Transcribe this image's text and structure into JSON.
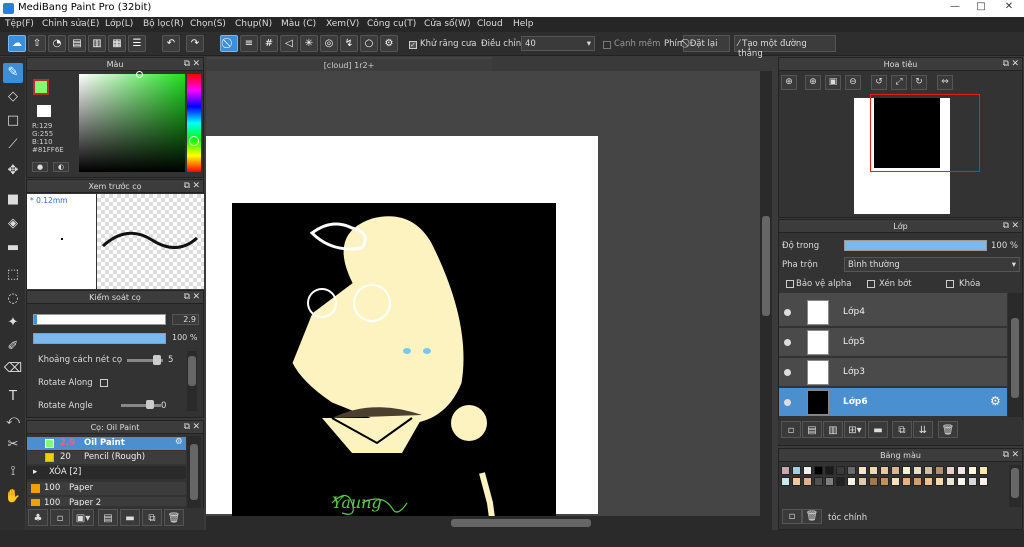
{
  "window": {
    "title": "MediBang Paint Pro (32bit)",
    "buttons": [
      "—",
      "□",
      "✕"
    ]
  },
  "menu": [
    "Tệp(F)",
    "Chỉnh sửa(E)",
    "Lớp(L)",
    "Bộ lọc(R)",
    "Chọn(S)",
    "Chụp(N)",
    "Màu (C)",
    "Xem(V)",
    "Công cụ(T)",
    "Cửa số(W)",
    "Cloud",
    "Help"
  ],
  "toolbar": {
    "antialias_label": "Khử răng cưa",
    "adjust_label": "Điều chỉnh",
    "adjust_value": "40",
    "edge_label": "Cạnh mềm",
    "shortcut_label": "Phím",
    "reset_label": "Đặt lại",
    "straight_label": "Tạo một đường thẳng"
  },
  "color_panel": {
    "title": "Màu",
    "r": "R:129",
    "g": "G:255",
    "b": "B:110",
    "hex": "#81FF6E",
    "accent": "#81FF6E"
  },
  "brush_preview": {
    "title": "Xem trước cọ",
    "size": "* 0.12mm"
  },
  "brush_control": {
    "title": "Kiểm soát cọ",
    "size": "2.9",
    "opacity": "100 %",
    "opacity_fraction": 1,
    "spacing_label": "Khoảng cách nét cọ",
    "spacing_value": "5",
    "rotate_along": "Rotate Along",
    "rotate_angle": "Rotate Angle",
    "rotate_value": "0"
  },
  "brush_list": {
    "title": "Cọ: Oil Paint",
    "items": [
      {
        "size": "2.9",
        "name": "Oil Paint",
        "selected": true,
        "color": "#81FF6E"
      },
      {
        "size": "20",
        "name": "Pencil (Rough)",
        "selected": false,
        "color": "#f0d000"
      },
      {
        "size": "",
        "name": "XÓA [2]",
        "group": true
      },
      {
        "size": "100",
        "name": "Paper",
        "color": "#f0a000"
      },
      {
        "size": "100",
        "name": "Paper 2",
        "color": "#f0a000"
      }
    ]
  },
  "canvas": {
    "tab": "[cloud] 1r2+",
    "signature": "Yaung"
  },
  "navigator": {
    "title": "Hoa tiêu"
  },
  "layers_panel": {
    "title": "Lớp",
    "opacity_label": "Độ trong",
    "opacity_value": "100 %",
    "opacity_fraction": 1,
    "blend_label": "Pha trộn",
    "blend_value": "Bình thường",
    "alpha_label": "Bảo vệ alpha",
    "clip_label": "Xén bớt",
    "lock_label": "Khóa",
    "layers": [
      {
        "name": "Lớp4"
      },
      {
        "name": "Lớp5"
      },
      {
        "name": "Lớp3"
      },
      {
        "name": "Lớp6",
        "selected": true
      }
    ]
  },
  "palette": {
    "title": "Bảng màu",
    "custom_label": "tóc chính",
    "colors": [
      "#c8a8b0",
      "#9fcfe8",
      "#f0f0f0",
      "#000000",
      "#1a1a1a",
      "#3a3a3a",
      "#6a6a6a",
      "#f5e6c8",
      "#f0d8b0",
      "#e8c8a0",
      "#d8b890",
      "#f8f0d0",
      "#e8e0c0",
      "#d0c0a0",
      "#b09070",
      "#e8d0c8",
      "#f0e8e8",
      "#fff8e0",
      "#f8e8b0",
      "#c8e8f0",
      "#f0c8a0",
      "#e0b090",
      "#505050",
      "#808080",
      "#202020",
      "#f8f0e0",
      "#e0c8a8",
      "#a07850",
      "#c09060",
      "#f8e0c0",
      "#e8b080",
      "#d0a070",
      "#f0c090",
      "#f8d8b0",
      "#e8e8d0",
      "#f8f8f0",
      "#d8d8d8",
      "#fff0f0"
    ]
  }
}
